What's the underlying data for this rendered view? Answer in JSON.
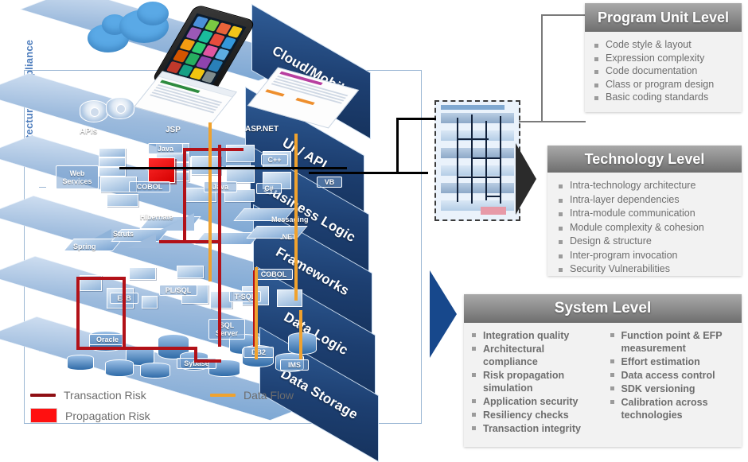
{
  "diagram": {
    "vertical_axis_label": "Architecture Compliance"
  },
  "stack": {
    "layers": [
      {
        "name": "Cloud/Mobile",
        "tags": []
      },
      {
        "name": "UI / API",
        "tags": [
          "APIs",
          "JSP",
          "ASP.NET"
        ]
      },
      {
        "name": "Business Logic",
        "tags": [
          "Web Services",
          "Java",
          "COBOL",
          "C++",
          "C#",
          "VB"
        ]
      },
      {
        "name": "Frameworks",
        "tags": [
          "Spring",
          "Struts",
          "Hibernate",
          "Messaging",
          ".NET"
        ]
      },
      {
        "name": "Data Logic",
        "tags": [
          "EJB",
          "PL/SQL",
          "T-SQL",
          "COBOL"
        ]
      },
      {
        "name": "Data Storage",
        "tags": [
          "Oracle",
          "Sybase",
          "SQL Server",
          "DB2",
          "IMS"
        ]
      }
    ],
    "tag_web_services": "Web\nServices",
    "tag_apis": "APIs",
    "tag_jsp": "JSP",
    "tag_aspnet": "ASP.NET",
    "tag_java_bl": "Java",
    "tag_java_bl2": "Java",
    "tag_cobol_bl": "COBOL",
    "tag_cpp": "C++",
    "tag_csharp": "C#",
    "tag_vb": "VB",
    "tag_spring": "Spring",
    "tag_struts": "Struts",
    "tag_hibernate": "Hibernate",
    "tag_messaging": "Messaging",
    "tag_dotnet": ".NET",
    "tag_ejb": "EJB",
    "tag_plsql": "PL/SQL",
    "tag_tsql": "T-SQL",
    "tag_cobol_dl": "COBOL",
    "tag_oracle": "Oracle",
    "tag_sybase": "Sybase",
    "tag_sqlserver": "SQL\nServer",
    "tag_db2": "DB2",
    "tag_ims": "IMS"
  },
  "legend": {
    "items": [
      {
        "label": "Transaction Risk",
        "color": "#8f0f14",
        "style": "line"
      },
      {
        "label": "Propagation Risk",
        "color": "#ff1010",
        "style": "box"
      },
      {
        "label": "Data Flow",
        "color": "#f0a22e",
        "style": "line"
      }
    ]
  },
  "panels": {
    "program_unit_level": {
      "title": "Program Unit Level",
      "items": [
        "Code style & layout",
        "Expression complexity",
        "Code documentation",
        "Class or program design",
        "Basic coding standards"
      ]
    },
    "technology_level": {
      "title": "Technology Level",
      "items": [
        "Intra-technology architecture",
        "Intra-layer dependencies",
        "Intra-module communication",
        "Module complexity & cohesion",
        "Design & structure",
        "Inter-program invocation",
        "Security Vulnerabilities"
      ]
    },
    "system_level": {
      "title": "System Level",
      "items_left": [
        "Integration quality",
        "Architectural compliance",
        "Risk propagation simulation",
        "Application security",
        "Resiliency checks",
        "Transaction integrity"
      ],
      "items_right": [
        "Function point & EFP measurement",
        "Effort estimation",
        "Data access control",
        "SDK versioning",
        "Calibration across technologies"
      ]
    }
  },
  "colors": {
    "accent_blue": "#17488c",
    "label_blue": "#4f7ebd",
    "risk_red": "#b21118",
    "flow_orange": "#f0a22e",
    "panel_header_gray": "#8f8f8f"
  }
}
